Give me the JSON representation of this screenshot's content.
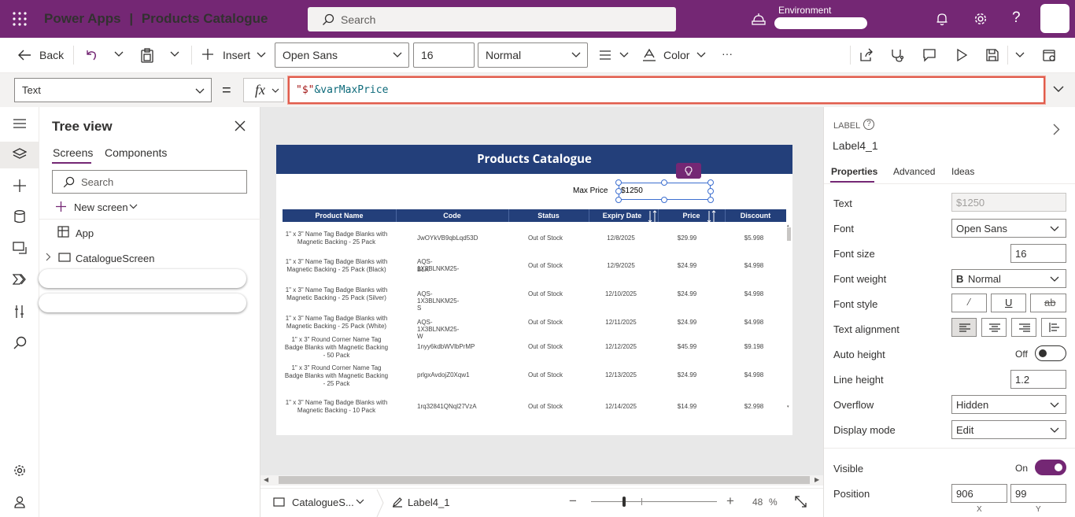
{
  "topbar": {
    "app_name": "Power Apps",
    "separator": "|",
    "app_title": "Products Catalogue",
    "search_placeholder": "Search",
    "environment_label": "Environment"
  },
  "toolbar": {
    "back": "Back",
    "insert": "Insert",
    "font": "Open Sans",
    "font_size": "16",
    "font_weight": "Normal",
    "color": "Color",
    "more": "···"
  },
  "formula_bar": {
    "property": "Text",
    "equals": "=",
    "fx": "fx",
    "formula_string": "\"$\"",
    "formula_rest": "&varMaxPrice"
  },
  "tree_view": {
    "title": "Tree view",
    "tabs": [
      "Screens",
      "Components"
    ],
    "search_placeholder": "Search",
    "new_screen": "New screen",
    "items": [
      "App",
      "CatalogueScreen"
    ]
  },
  "canvas": {
    "header": "Products Catalogue",
    "max_price_label": "Max Price",
    "max_price_value": "$1250",
    "columns": [
      "Product Name",
      "Code",
      "Status",
      "Expiry Date",
      "Price",
      "Discount"
    ],
    "rows": [
      {
        "name": [
          "1\" x 3\" Name Tag Badge Blanks with",
          "Magnetic Backing - 25 Pack"
        ],
        "code": [
          "JwOYkVB9qbLqd53D"
        ],
        "status": "Out of Stock",
        "expiry": "12/8/2025",
        "price": "$29.99",
        "discount": "$5.998"
      },
      {
        "name": [
          "1\" x 3\" Name Tag Badge Blanks with",
          "Magnetic Backing - 25 Pack (Black)"
        ],
        "code": [
          "AQS-1X3BLNKM25-",
          "BLK"
        ],
        "status": "Out of Stock",
        "expiry": "12/9/2025",
        "price": "$24.99",
        "discount": "$4.998"
      },
      {
        "name": [
          "1\" x 3\" Name Tag Badge Blanks with",
          "Magnetic Backing - 25 Pack (Silver)"
        ],
        "code": [
          "AQS-1X3BLNKM25-S"
        ],
        "status": "Out of Stock",
        "expiry": "12/10/2025",
        "price": "$24.99",
        "discount": "$4.998"
      },
      {
        "name": [
          "1\" x 3\" Name Tag Badge Blanks with",
          "Magnetic Backing - 25 Pack (White)"
        ],
        "code": [
          "AQS-1X3BLNKM25-W"
        ],
        "status": "Out of Stock",
        "expiry": "12/11/2025",
        "price": "$24.99",
        "discount": "$4.998"
      },
      {
        "name": [
          "1\" x 3\" Round Corner Name Tag",
          "Badge Blanks with Magnetic Backing",
          "- 50 Pack"
        ],
        "code": [
          "1nyy6kdbWVlbPrMP"
        ],
        "status": "Out of Stock",
        "expiry": "12/12/2025",
        "price": "$45.99",
        "discount": "$9.198"
      },
      {
        "name": [
          "1\" x 3\" Round Corner Name Tag",
          "Badge Blanks with Magnetic Backing",
          "- 25 Pack"
        ],
        "code": [
          "prlgxAvdojZ0Xqw1"
        ],
        "status": "Out of Stock",
        "expiry": "12/13/2025",
        "price": "$24.99",
        "discount": "$4.998"
      },
      {
        "name": [
          "1\" x 3\" Name Tag Badge Blanks with",
          "Magnetic Backing - 10 Pack"
        ],
        "code": [
          "1rq32841QNql27VzA"
        ],
        "status": "Out of Stock",
        "expiry": "12/14/2025",
        "price": "$14.99",
        "discount": "$2.998"
      }
    ]
  },
  "statusbar": {
    "screen": "CatalogueS...",
    "control": "Label4_1",
    "zoom_minus": "−",
    "zoom_plus": "+",
    "zoom_value": "48",
    "zoom_unit": "%",
    "zoom_level": 0.48
  },
  "properties_panel": {
    "type": "LABEL",
    "control_name": "Label4_1",
    "tabs": [
      "Properties",
      "Advanced",
      "Ideas"
    ],
    "text_label": "Text",
    "text_value": "$1250",
    "font_label": "Font",
    "font_value": "Open Sans",
    "font_size_label": "Font size",
    "font_size_value": "16",
    "font_weight_label": "Font weight",
    "font_weight_value": "Normal",
    "font_style_label": "Font style",
    "text_alignment_label": "Text alignment",
    "auto_height_label": "Auto height",
    "auto_height_value": "Off",
    "line_height_label": "Line height",
    "line_height_value": "1.2",
    "overflow_label": "Overflow",
    "overflow_value": "Hidden",
    "display_mode_label": "Display mode",
    "display_mode_value": "Edit",
    "visible_label": "Visible",
    "visible_value": "On",
    "position_label": "Position",
    "position_x": "906",
    "position_y": "99",
    "x_label": "X",
    "y_label": "Y"
  },
  "colors": {
    "brand": "#742774",
    "canvas_header": "#233f7a",
    "formula_highlight": "#e05c4c"
  }
}
